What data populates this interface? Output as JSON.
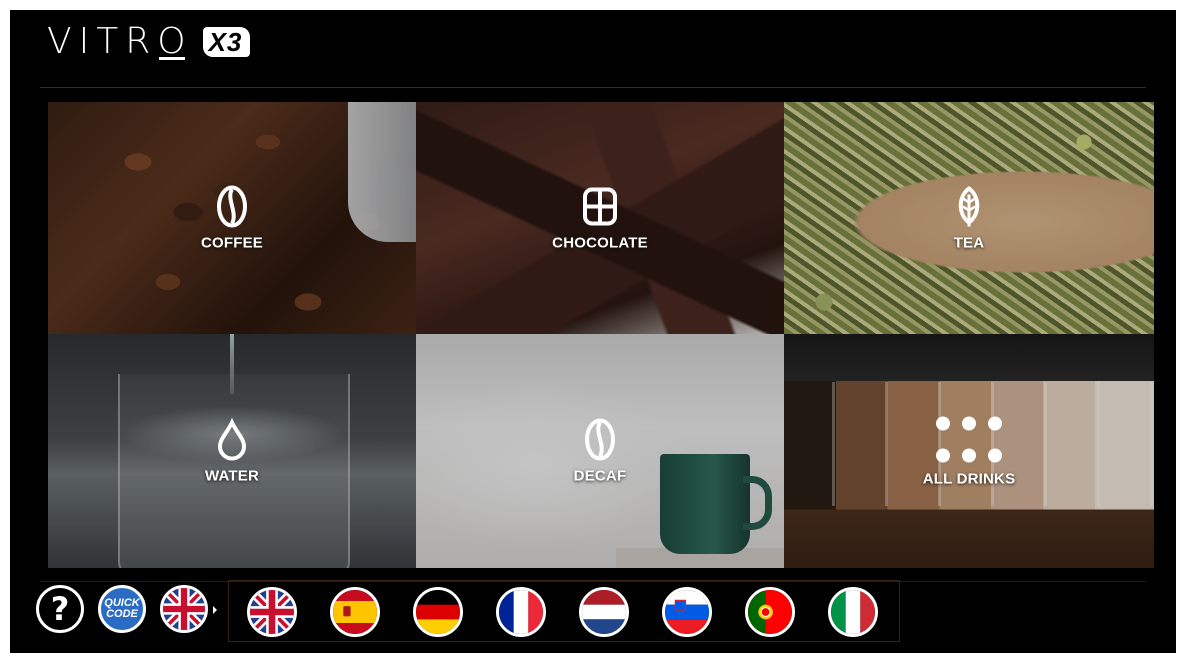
{
  "header": {
    "logo_word": "VITRO",
    "logo_badge": "X3"
  },
  "categories": [
    {
      "label": "COFFEE",
      "icon": "coffee-bean-icon"
    },
    {
      "label": "CHOCOLATE",
      "icon": "chocolate-bar-icon"
    },
    {
      "label": "TEA",
      "icon": "tea-leaf-icon"
    },
    {
      "label": "WATER",
      "icon": "water-drop-icon"
    },
    {
      "label": "DECAF",
      "icon": "coffee-bean-icon"
    },
    {
      "label": "ALL DRINKS",
      "icon": "grid-dots-icon"
    }
  ],
  "footer": {
    "help_label": "?",
    "quick_code_line1": "QUICK",
    "quick_code_line2": "CODE",
    "current_language": "uk-flag-icon",
    "languages": [
      "uk-flag-icon",
      "spain-flag-icon",
      "germany-flag-icon",
      "france-flag-icon",
      "netherlands-flag-icon",
      "slovenia-flag-icon",
      "portugal-flag-icon",
      "italy-flag-icon"
    ]
  },
  "colors": {
    "background": "#000000",
    "quick_code_blue": "#2a6cc4",
    "divider_brown": "#3a2b1e"
  }
}
